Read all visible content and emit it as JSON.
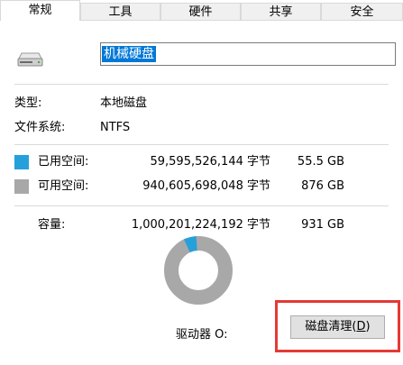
{
  "tabs": [
    "常规",
    "工具",
    "硬件",
    "共享",
    "安全"
  ],
  "drive": {
    "name": "机械硬盘",
    "icon": "hard-drive-icon"
  },
  "info": {
    "type_label": "类型:",
    "type_value": "本地磁盘",
    "fs_label": "文件系统:",
    "fs_value": "NTFS"
  },
  "usage": {
    "used_label": "已用空间:",
    "used_bytes": "59,595,526,144 字节",
    "used_size": "55.5 GB",
    "free_label": "可用空间:",
    "free_bytes": "940,605,698,048 字节",
    "free_size": "876 GB",
    "capacity_label": "容量:",
    "capacity_bytes": "1,000,201,224,192 字节",
    "capacity_size": "931 GB",
    "used_fraction": 0.0596
  },
  "drive_label": "驱动器 O:",
  "cleanup_button": "磁盘清理(",
  "cleanup_mnemonic": "D",
  "cleanup_close": ")",
  "colors": {
    "used": "#26a0da",
    "free": "#a8a8a8",
    "accent": "#0078d7",
    "highlight": "#e53935"
  }
}
